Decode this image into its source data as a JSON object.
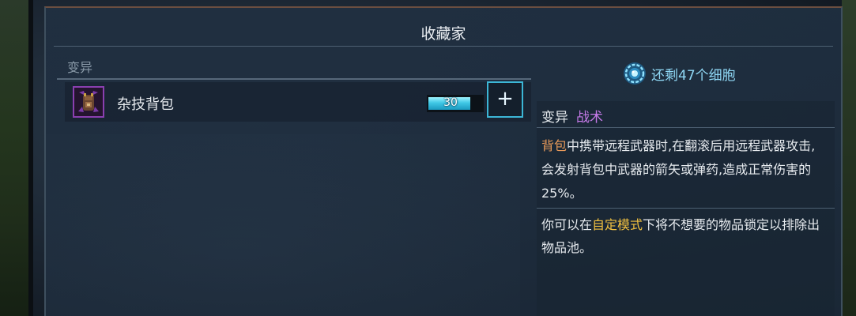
{
  "panel": {
    "title": "收藏家"
  },
  "section": {
    "label": "变异"
  },
  "item": {
    "name": "杂技背包",
    "cost": "30",
    "cost_fill_fraction": 0.95,
    "add_label": "+",
    "icon": "acrobatic-backpack-icon"
  },
  "cells": {
    "icon": "cell-icon",
    "text": "还剩47个细胞"
  },
  "description": {
    "category": "变异",
    "type": "战术",
    "para1_hl": "背包",
    "para1_rest": "中携带远程武器时,在翻滚后用远程武器攻击,会发射背包中武器的箭矢或弹药,造成正常伤害的25%。",
    "para2_pre": "你可以在",
    "para2_hl": "自定模式",
    "para2_post": "下将不想要的物品锁定以排除出物品池。"
  },
  "colors": {
    "accent_cyan": "#3cb6d6",
    "tactics_purple": "#c57ae8",
    "highlight_orange": "#e89a5a",
    "highlight_yellow": "#f0c040"
  }
}
